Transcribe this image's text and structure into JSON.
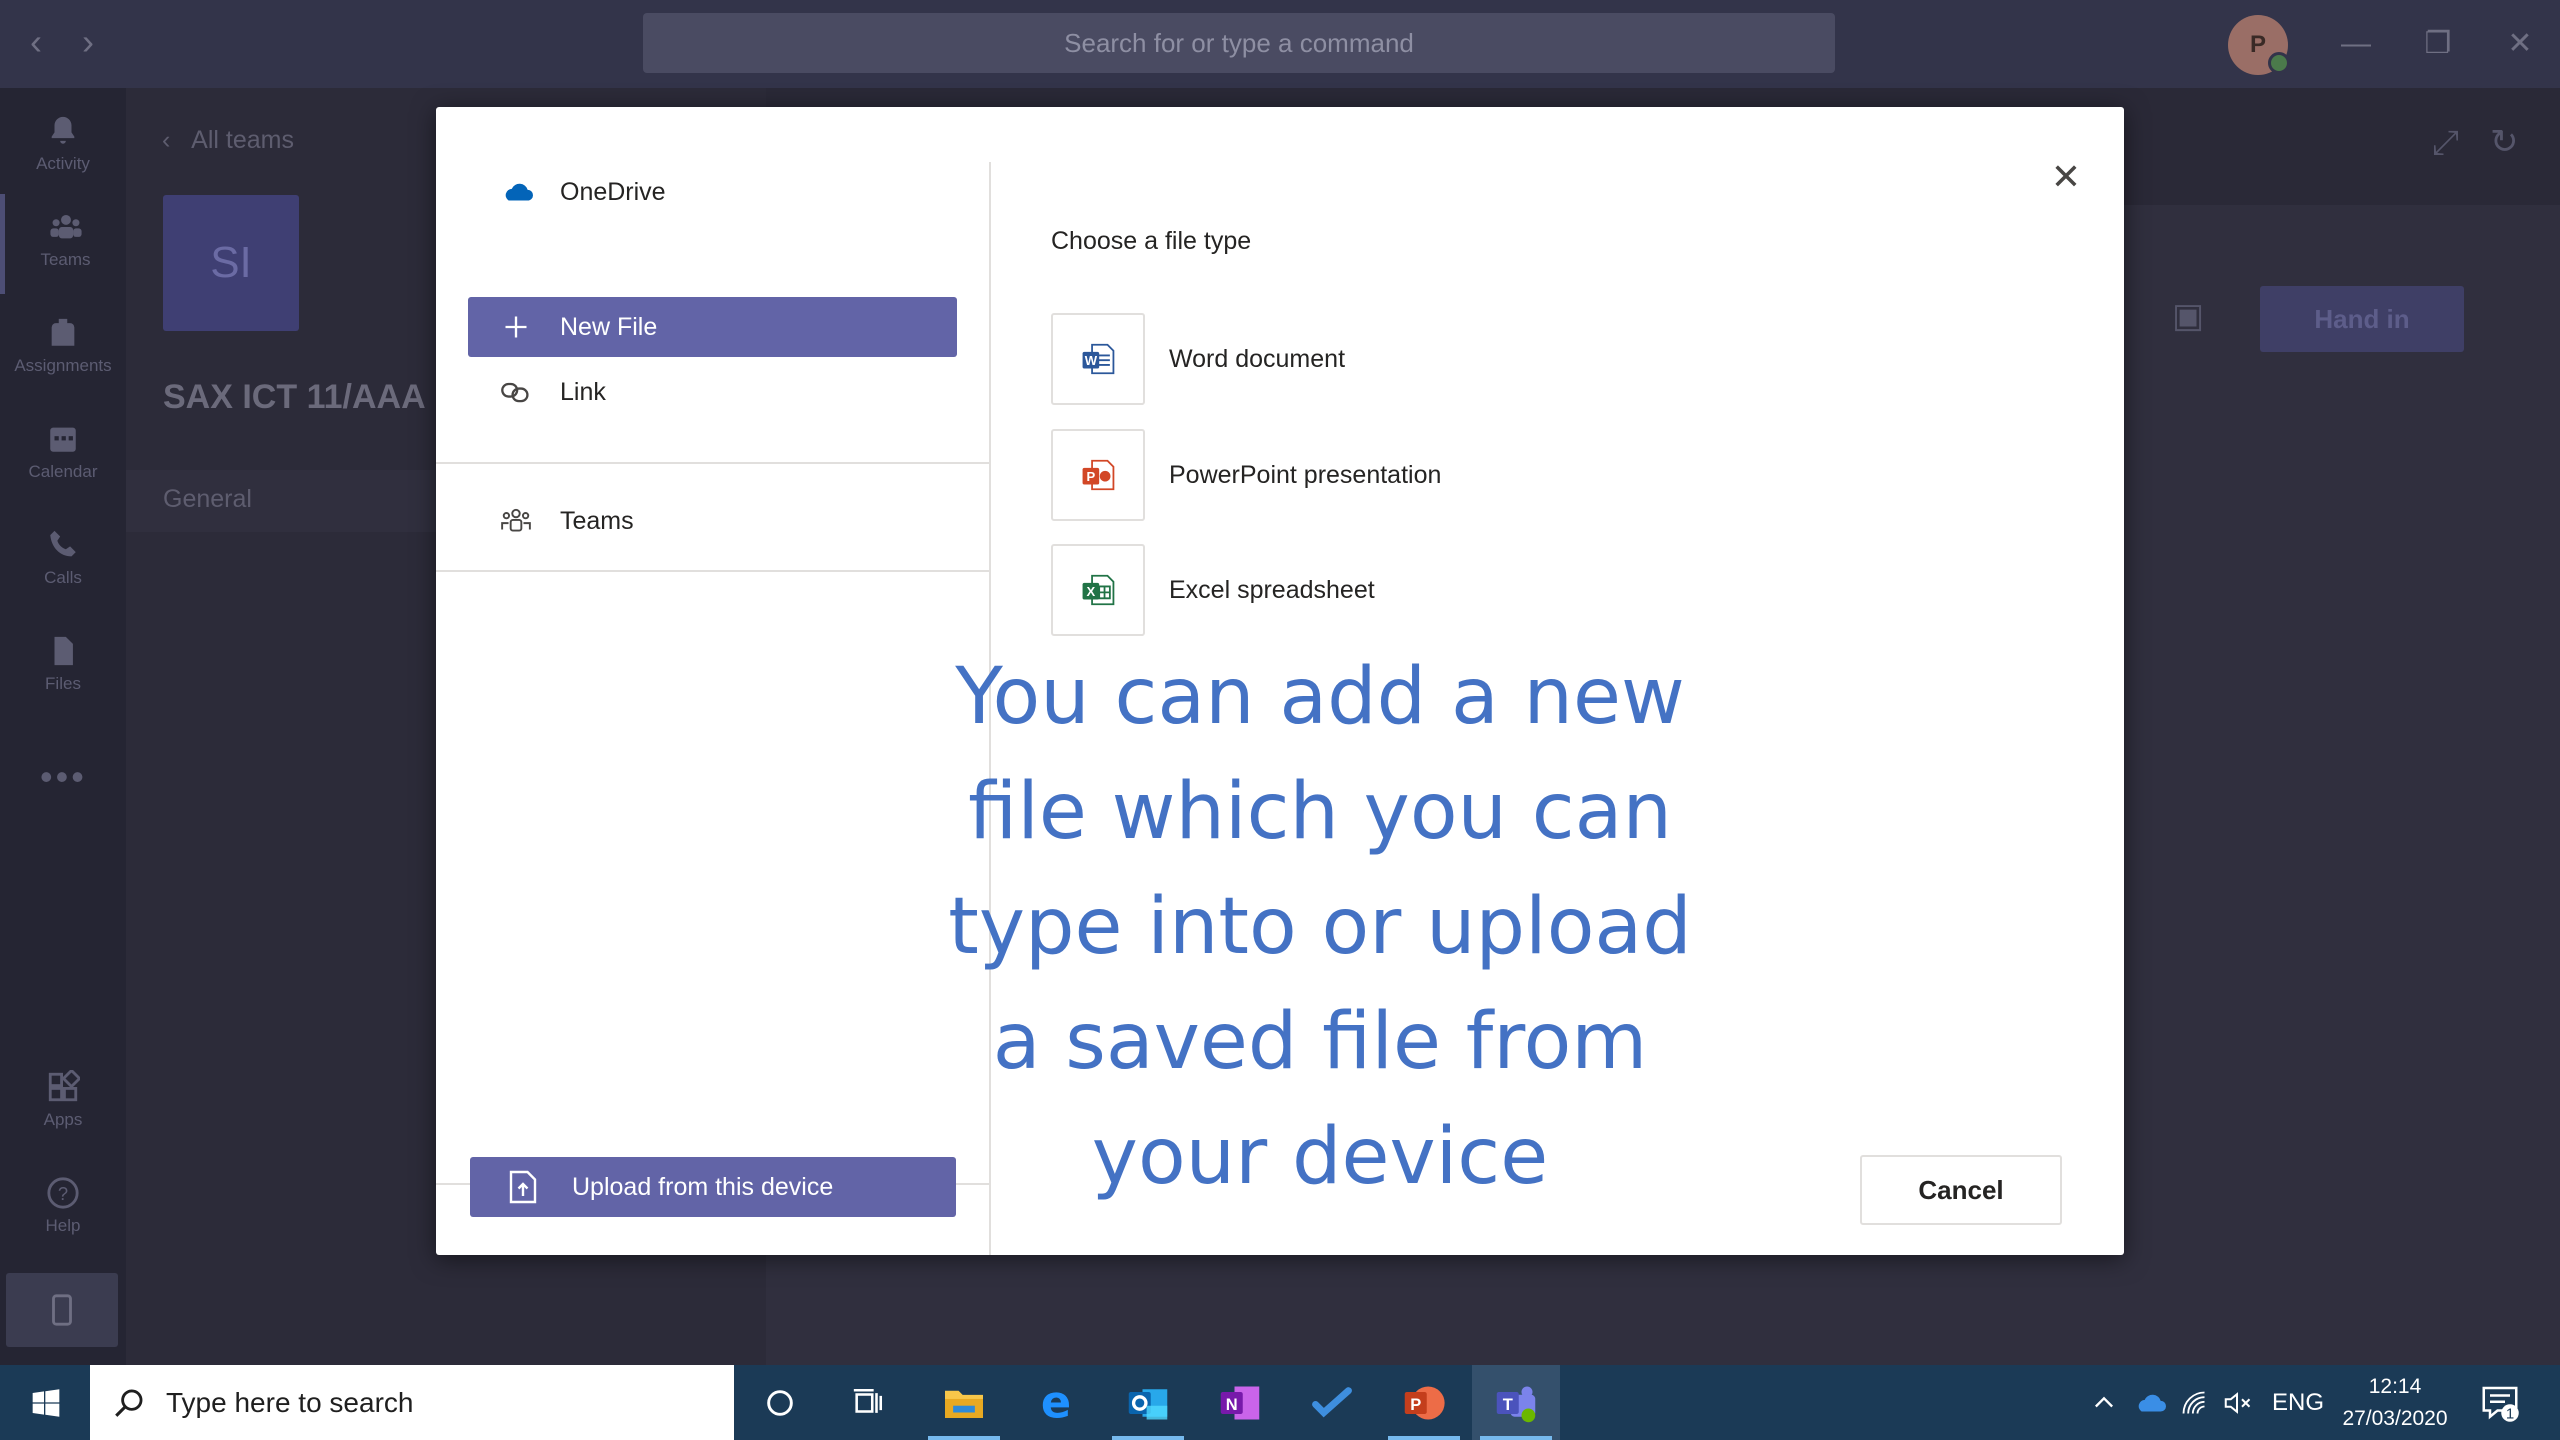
{
  "titlebar": {
    "search_placeholder": "Search for or type a command",
    "avatar_initial": "P"
  },
  "rail": {
    "items": [
      {
        "label": "Activity",
        "icon": "bell-icon"
      },
      {
        "label": "Teams",
        "icon": "teams-icon"
      },
      {
        "label": "Assignments",
        "icon": "backpack-icon"
      },
      {
        "label": "Calendar",
        "icon": "calendar-icon"
      },
      {
        "label": "Calls",
        "icon": "phone-icon"
      },
      {
        "label": "Files",
        "icon": "file-icon"
      }
    ],
    "more": "•••",
    "apps_label": "Apps",
    "help_label": "Help"
  },
  "team_panel": {
    "back_label": "All teams",
    "tile_initials": "SI",
    "team_name": "SAX ICT 11/AAA",
    "channel": "General"
  },
  "content": {
    "hand_in_label": "Hand in"
  },
  "modal": {
    "sources": [
      {
        "label": "OneDrive",
        "icon": "onedrive-cloud-icon"
      },
      {
        "label": "New File",
        "icon": "plus-icon",
        "selected": true
      },
      {
        "label": "Link",
        "icon": "link-icon"
      },
      {
        "label": "Teams",
        "icon": "teams-people-icon"
      }
    ],
    "upload_label": "Upload from this device",
    "choose_label": "Choose a file type",
    "file_types": [
      {
        "label": "Word document",
        "icon": "word-icon",
        "color": "#2b579a",
        "letter": "W"
      },
      {
        "label": "PowerPoint presentation",
        "icon": "powerpoint-icon",
        "color": "#d24726",
        "letter": "P"
      },
      {
        "label": "Excel spreadsheet",
        "icon": "excel-icon",
        "color": "#217346",
        "letter": "X"
      }
    ],
    "cancel_label": "Cancel",
    "close_glyph": "✕"
  },
  "annotation": {
    "lines": [
      "You can add a new",
      "file which you can",
      "type into or upload",
      "a saved file from",
      "your device"
    ],
    "color": "#4472c4"
  },
  "taskbar": {
    "search_placeholder": "Type here to search",
    "language": "ENG",
    "time": "12:14",
    "date": "27/03/2020",
    "notification_count": "1"
  }
}
